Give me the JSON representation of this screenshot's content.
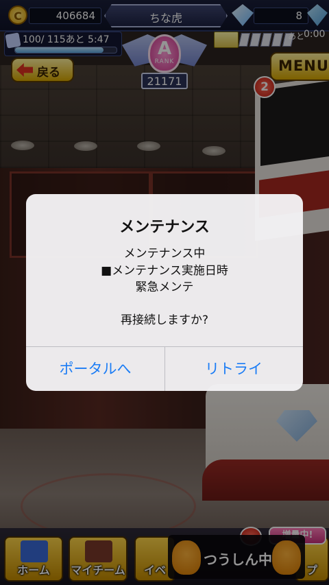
{
  "hud": {
    "coins": "406684",
    "player_name": "ちな虎",
    "gems": "8",
    "stamina_text": "100/ 115あと  5:47",
    "stamina_level": 0.87,
    "rank_letter": "A",
    "rank_word": "RANK",
    "rank_points": "21171",
    "ticket_label": "あと",
    "ticket_time": "0:00",
    "ticket_slots_filled": 5,
    "ticket_slots_total": 5
  },
  "nav_buttons": {
    "back_label": "戻る",
    "menu_label": "MENU",
    "notification_count": "2"
  },
  "alert": {
    "title": "メンテナンス",
    "lines": [
      "メンテナンス中",
      "■メンテナンス実施日時",
      "緊急メンテ",
      "",
      "再接続しますか?"
    ],
    "buttons": {
      "portal": "ポータルへ",
      "retry": "リトライ"
    }
  },
  "bottom_nav": {
    "home": "ホーム",
    "my_team": "マイチーム",
    "event": "イベ",
    "shop": "プ",
    "communication_status": "つうしん中",
    "boost_tag": "増量中!"
  },
  "colors": {
    "alert_button": "#1a7cf5",
    "hud_bg": "#1a1f3a",
    "gold_button": "#d7a700"
  }
}
